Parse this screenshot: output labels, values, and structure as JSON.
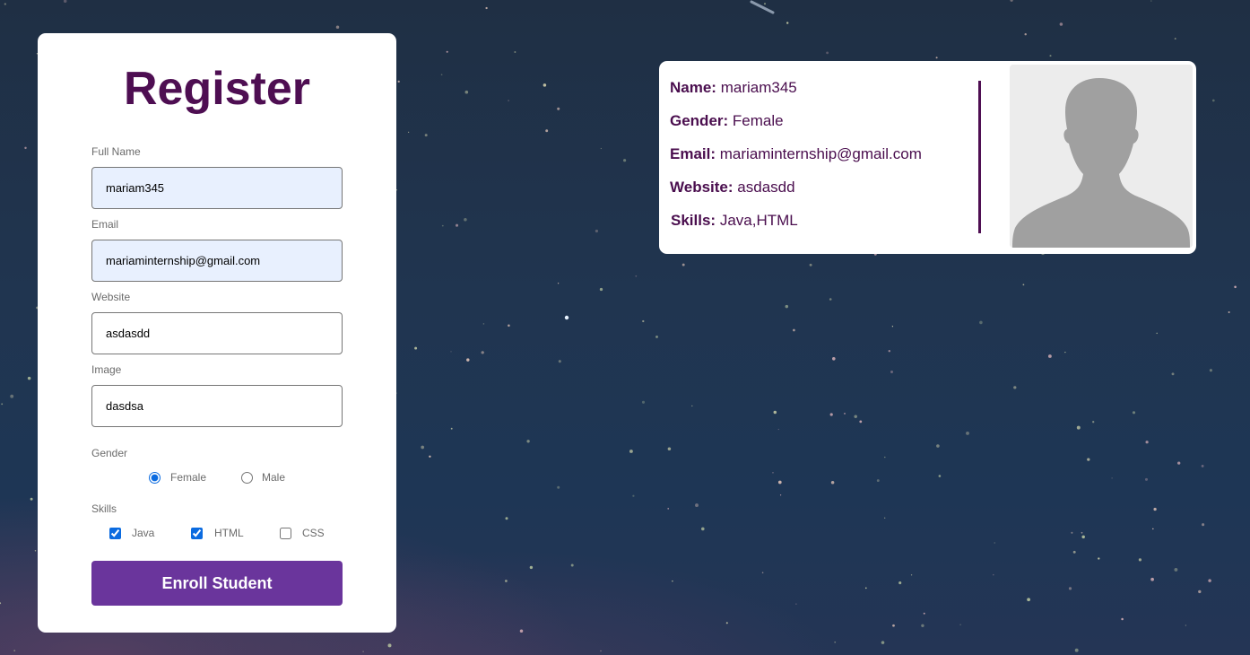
{
  "form": {
    "title": "Register",
    "full_name": {
      "label": "Full Name",
      "value": "mariam345"
    },
    "email": {
      "label": "Email",
      "value": "mariaminternship@gmail.com"
    },
    "website": {
      "label": "Website",
      "value": "asdasdd"
    },
    "image": {
      "label": "Image",
      "value": "dasdsa"
    },
    "gender": {
      "label": "Gender",
      "options": [
        {
          "label": "Female",
          "checked": true
        },
        {
          "label": "Male",
          "checked": false
        }
      ]
    },
    "skills": {
      "label": "Skills",
      "options": [
        {
          "label": "Java",
          "checked": true
        },
        {
          "label": "HTML",
          "checked": true
        },
        {
          "label": "CSS",
          "checked": false
        }
      ]
    },
    "submit_label": "Enroll Student"
  },
  "card": {
    "rows": [
      {
        "key": "Name:",
        "value": "mariam345"
      },
      {
        "key": "Gender:",
        "value": "Female"
      },
      {
        "key": "Email:",
        "value": "mariaminternship@gmail.com"
      },
      {
        "key": "Website:",
        "value": "asdasdd"
      },
      {
        "key": "Skills:",
        "value": "Java,HTML"
      }
    ],
    "avatar_icon": "person-silhouette-icon"
  },
  "colors": {
    "accent": "#4e0e52",
    "button": "#6a359c",
    "autofill": "#e8f0fe",
    "control": "#0b6be0"
  }
}
